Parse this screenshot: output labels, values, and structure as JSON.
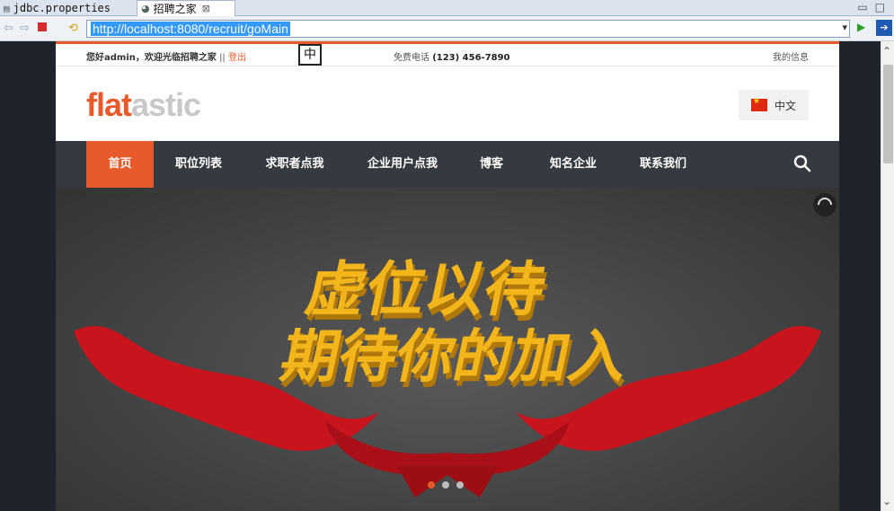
{
  "tabs": [
    {
      "label": "jdbc.properties",
      "icon": "file-icon"
    },
    {
      "label": "招聘之家",
      "icon": "globe-icon"
    }
  ],
  "browser": {
    "url": "http://localhost:8080/recruit/goMain"
  },
  "ime": {
    "label": "中"
  },
  "topbar": {
    "greeting": "您好admin，欢迎光临招聘之家",
    "separator": "||",
    "logout": "登出",
    "phone_label": "免费电话",
    "phone_number": "(123) 456-7890",
    "my_info": "我的信息"
  },
  "logo": {
    "part1": "flat",
    "part2": "astic"
  },
  "language": {
    "label": "中文"
  },
  "nav": [
    {
      "label": "首页"
    },
    {
      "label": "职位列表"
    },
    {
      "label": "求职者点我"
    },
    {
      "label": "企业用户点我"
    },
    {
      "label": "博客"
    },
    {
      "label": "知名企业"
    },
    {
      "label": "联系我们"
    }
  ],
  "banner": {
    "line1": "虚位以待",
    "line2": "期待你的加入",
    "slide_count": 3,
    "active_slide": 1
  },
  "colors": {
    "accent": "#e85a2b",
    "nav_bg": "#343a40",
    "banner_text": "#f2b51c",
    "ribbon": "#c8141c"
  }
}
